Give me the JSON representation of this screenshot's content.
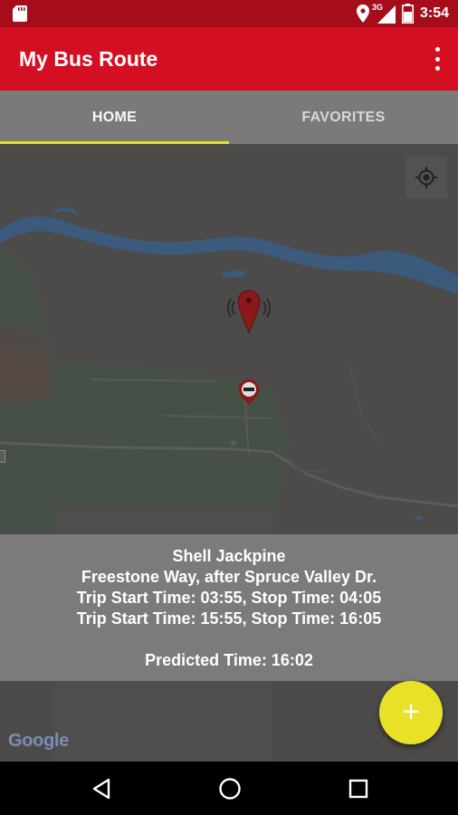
{
  "status_bar": {
    "time": "3:54",
    "network": "3G",
    "icons": [
      "sd-card-icon",
      "location-icon",
      "signal-icon",
      "battery-icon"
    ]
  },
  "app_bar": {
    "title": "My Bus Route",
    "menu_icon": "overflow-menu-icon"
  },
  "tabs": [
    {
      "label": "HOME",
      "selected": true
    },
    {
      "label": "FAVORITES",
      "selected": false
    }
  ],
  "map": {
    "locate_icon": "my-location-icon",
    "attribution": "Google"
  },
  "info_panel": {
    "stop_name": "Shell Jackpine",
    "location": "Freestone Way, after Spruce Valley Dr.",
    "trip_1": "Trip Start Time: 03:55, Stop Time: 04:05",
    "trip_2": "Trip Start Time: 15:55, Stop Time: 16:05",
    "predicted": "Predicted Time: 16:02"
  },
  "fab": {
    "label": "+",
    "icon": "add-icon"
  },
  "nav_bar": {
    "icons": [
      "back-icon",
      "home-icon",
      "recents-icon"
    ]
  },
  "colors": {
    "status_bar": "#a50d1b",
    "app_bar": "#d40f22",
    "tabs": "#7a7a7a",
    "tab_indicator": "#e9de2a",
    "fab": "#e9e128",
    "info_panel": "#7b7b7b"
  }
}
